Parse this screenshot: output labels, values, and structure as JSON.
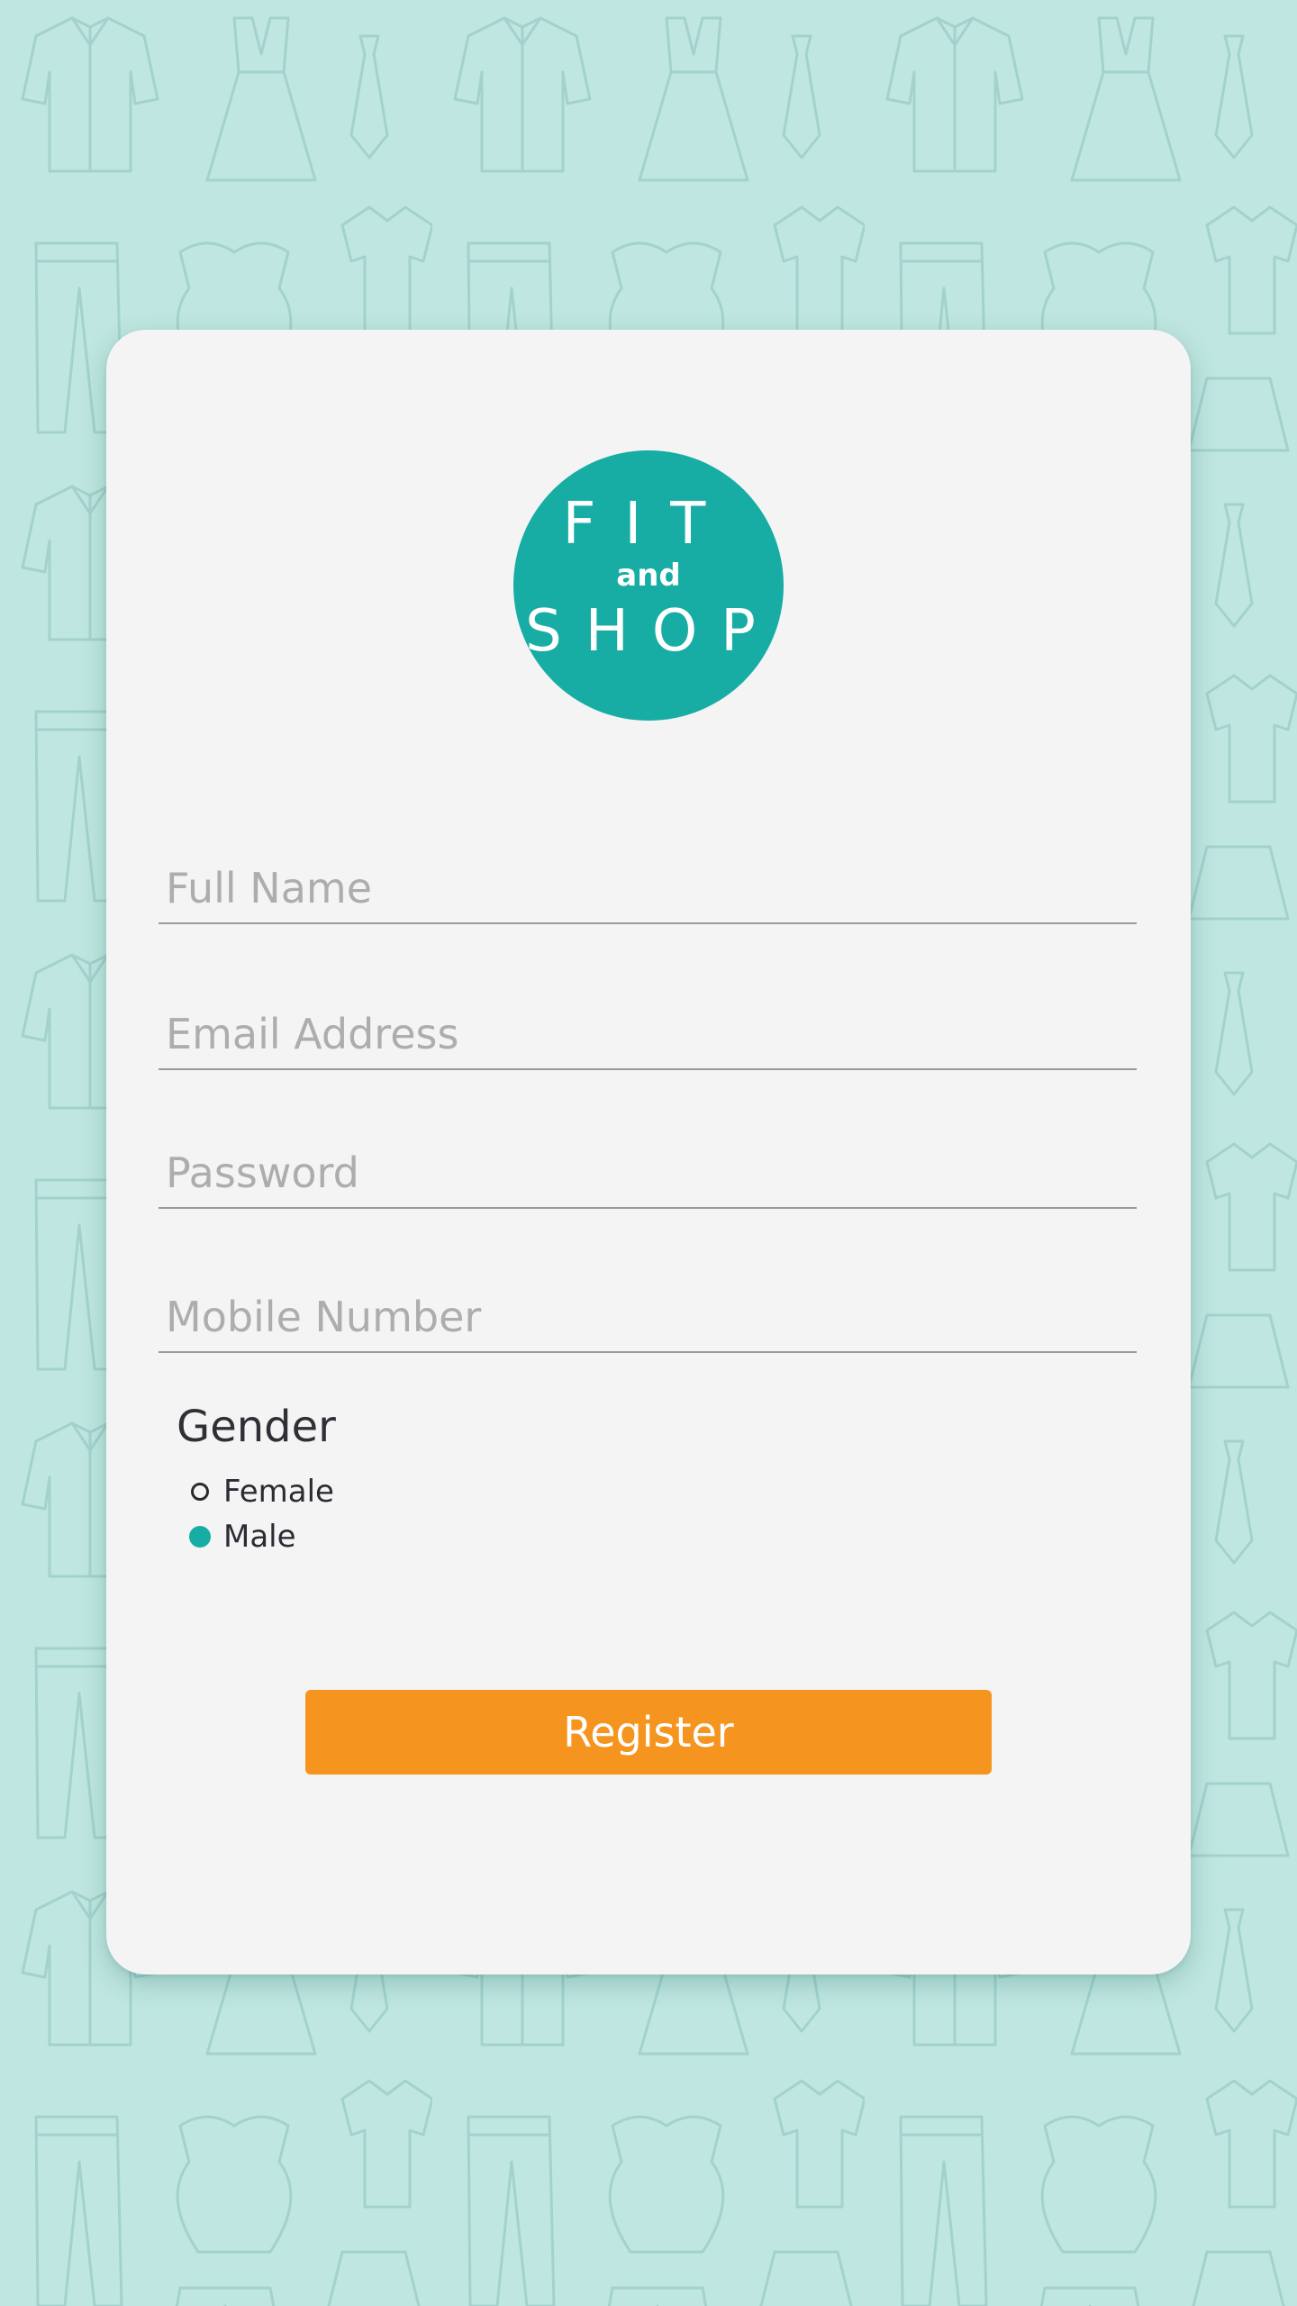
{
  "colors": {
    "background": "#bfe6e1",
    "pattern_stroke": "#9fcfca",
    "card": "#f4f4f4",
    "brand_teal": "#17ada4",
    "accent_orange": "#f5951f",
    "underline": "#9b9b9b",
    "placeholder": "#adadad"
  },
  "background": {
    "pattern_icon": "clothing-outline-pattern-icon"
  },
  "logo": {
    "line1": "FIT",
    "line2": "and",
    "line3": "SHOP"
  },
  "form": {
    "full_name": {
      "placeholder": "Full Name",
      "value": ""
    },
    "email": {
      "placeholder": "Email Address",
      "value": ""
    },
    "password": {
      "placeholder": "Password",
      "value": ""
    },
    "mobile": {
      "placeholder": "Mobile Number",
      "value": ""
    }
  },
  "gender": {
    "title": "Gender",
    "options": [
      {
        "label": "Female",
        "selected": false
      },
      {
        "label": "Male",
        "selected": true
      }
    ]
  },
  "register_label": "Register"
}
